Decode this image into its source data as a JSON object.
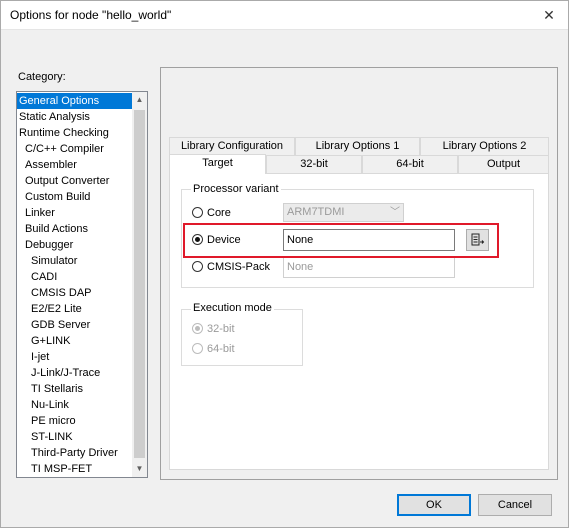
{
  "window": {
    "title": "Options for node \"hello_world\""
  },
  "category": {
    "label": "Category:",
    "items": [
      {
        "label": "General Options",
        "level": 0,
        "selected": true
      },
      {
        "label": "Static Analysis",
        "level": 0
      },
      {
        "label": "Runtime Checking",
        "level": 0
      },
      {
        "label": "C/C++ Compiler",
        "level": 1
      },
      {
        "label": "Assembler",
        "level": 1
      },
      {
        "label": "Output Converter",
        "level": 1
      },
      {
        "label": "Custom Build",
        "level": 1
      },
      {
        "label": "Linker",
        "level": 1
      },
      {
        "label": "Build Actions",
        "level": 1
      },
      {
        "label": "Debugger",
        "level": 1
      },
      {
        "label": "Simulator",
        "level": 2
      },
      {
        "label": "CADI",
        "level": 2
      },
      {
        "label": "CMSIS DAP",
        "level": 2
      },
      {
        "label": "E2/E2 Lite",
        "level": 2
      },
      {
        "label": "GDB Server",
        "level": 2
      },
      {
        "label": "G+LINK",
        "level": 2
      },
      {
        "label": "I-jet",
        "level": 2
      },
      {
        "label": "J-Link/J-Trace",
        "level": 2
      },
      {
        "label": "TI Stellaris",
        "level": 2
      },
      {
        "label": "Nu-Link",
        "level": 2
      },
      {
        "label": "PE micro",
        "level": 2
      },
      {
        "label": "ST-LINK",
        "level": 2
      },
      {
        "label": "Third-Party Driver",
        "level": 2
      },
      {
        "label": "TI MSP-FET",
        "level": 2
      }
    ]
  },
  "tabs": {
    "back_row": [
      "Library Configuration",
      "Library Options 1",
      "Library Options 2"
    ],
    "front_row": [
      "Target",
      "32-bit",
      "64-bit",
      "Output"
    ],
    "active": "Target"
  },
  "processor_variant": {
    "label": "Processor variant",
    "core_label": "Core",
    "core_value": "ARM7TDMI",
    "device_label": "Device",
    "device_value": "None",
    "cmsis_label": "CMSIS-Pack",
    "cmsis_value": "None",
    "selected": "Device"
  },
  "execution_mode": {
    "label": "Execution mode",
    "option_32": "32-bit",
    "option_64": "64-bit",
    "selected": "32-bit",
    "enabled": false
  },
  "buttons": {
    "ok": "OK",
    "cancel": "Cancel"
  },
  "colors": {
    "selection": "#0078d7",
    "highlight": "#e0192a"
  }
}
